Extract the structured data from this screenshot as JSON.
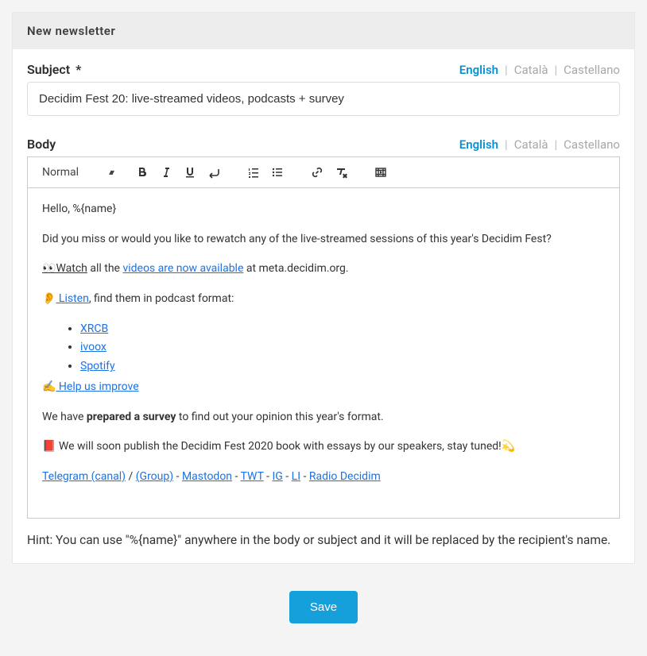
{
  "header": {
    "title": "New newsletter"
  },
  "subject": {
    "label": "Subject",
    "required": "*",
    "value": "Decidim Fest 20: live-streamed videos, podcasts + survey"
  },
  "body": {
    "label": "Body"
  },
  "langs": {
    "en": "English",
    "ca": "Català",
    "es": "Castellano"
  },
  "toolbar": {
    "style": "Normal"
  },
  "content": {
    "greeting": "Hello, %{name}",
    "p1": "Did you miss or would you like to rewatch any of the live-streamed sessions of this year's Decidim Fest?",
    "watch_emoji": " 👀",
    "watch_label": "Watch",
    "watch_mid": " all the ",
    "watch_link": "videos are now available",
    "watch_tail": " at meta.decidim.org.",
    "listen_emoji": "👂",
    "listen_link": " Listen",
    "listen_tail": ", find them in podcast format:",
    "pod1": "XRCB",
    "pod2": "ivoox",
    "pod3": "Spotify",
    "help_emoji": "✍️",
    "help_text": " Help us improve",
    "survey_pre": "We have ",
    "survey_bold": "prepared a survey",
    "survey_post": " to find out your opinion this year's format.",
    "book": "📕 We will soon publish the Decidim Fest 2020 book with essays by our speakers, stay tuned!💫",
    "tg_canal": "Telegram (canal)",
    "slash": " / ",
    "tg_group": " (Group)",
    "dash": " - ",
    "mastodon": "Mastodon",
    "twt": " TWT",
    "ig": " IG",
    "li": " LI",
    "radio": " Radio Decidim"
  },
  "hint": "Hint: You can use \"%{name}\" anywhere in the body or subject and it will be replaced by the recipient's name.",
  "actions": {
    "save": "Save"
  }
}
